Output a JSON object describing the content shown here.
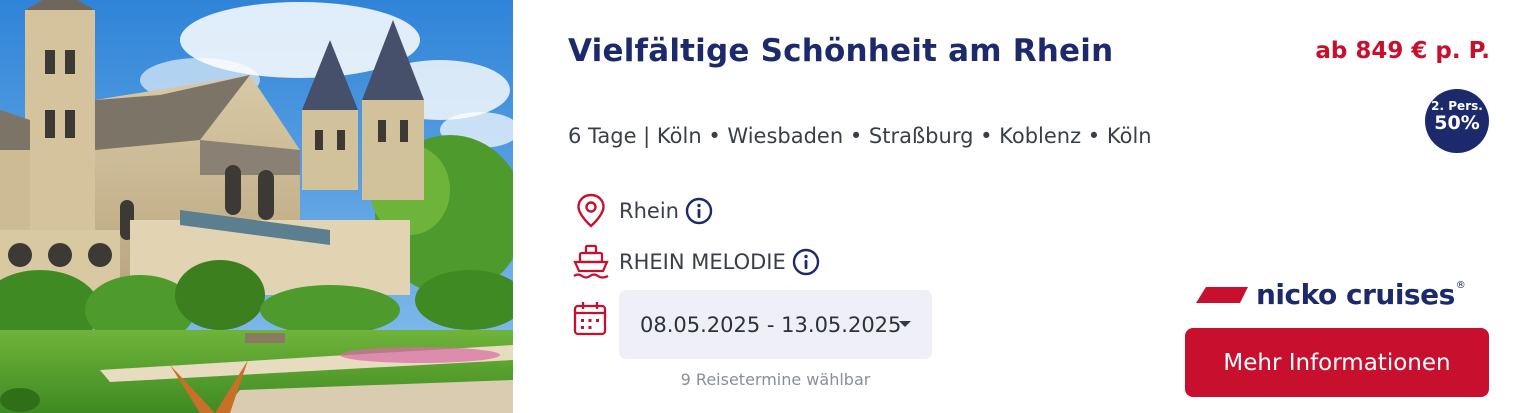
{
  "offer": {
    "title": "Vielfältige Schönheit am Rhein",
    "price": "ab 849 € p. P.",
    "badge": {
      "small": "2. Pers.",
      "big": "50%"
    },
    "route": "6 Tage | Köln • Wiesbaden • Straßburg • Koblenz • Köln",
    "river": "Rhein",
    "ship": "RHEIN MELODIE",
    "date_range": "08.05.2025 - 13.05.2025",
    "dates_note": "9 Reisetermine wählbar",
    "brand": {
      "name": "nicko cruises",
      "reg": "®"
    },
    "cta_label": "Mehr Informationen"
  },
  "icons": {
    "location": "map-pin-icon",
    "ship": "ship-icon",
    "calendar": "calendar-icon",
    "info": "info-icon",
    "caret": "caret-down-icon"
  },
  "colors": {
    "navy": "#1c2a6b",
    "red": "#c8102e",
    "select_bg": "#eeeff7",
    "muted": "#8a8f97"
  }
}
